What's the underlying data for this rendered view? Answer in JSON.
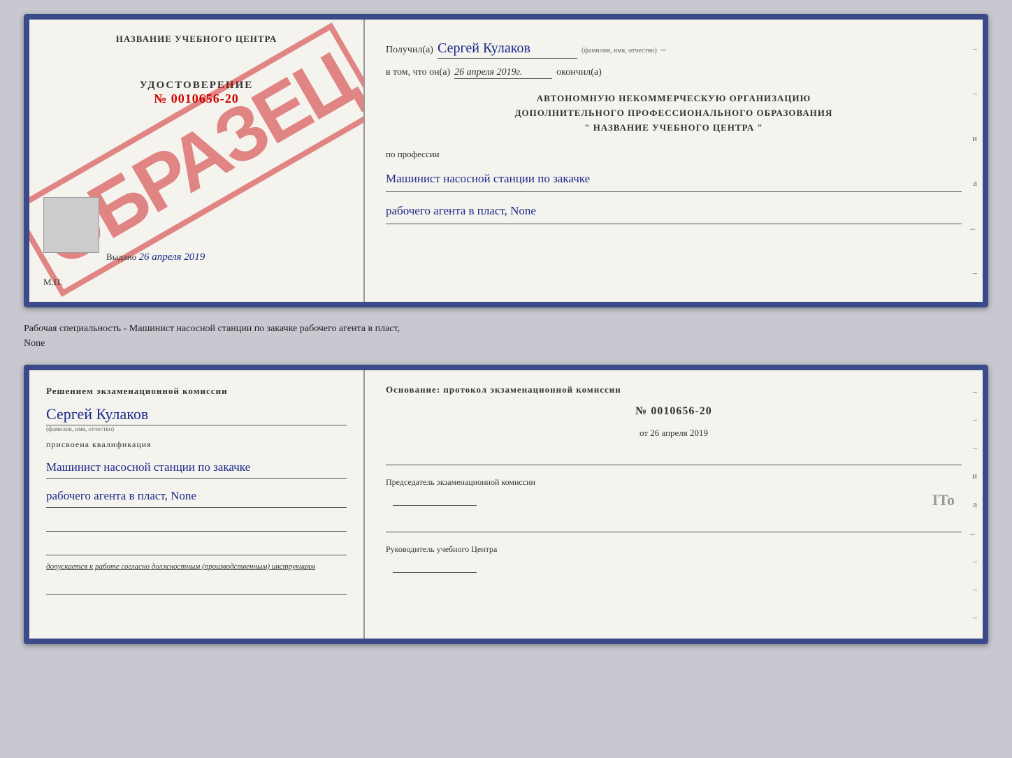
{
  "top_left": {
    "school_name": "НАЗВАНИЕ УЧЕБНОГО ЦЕНТРА",
    "cert_title": "УДОСТОВЕРЕНИЕ",
    "cert_number": "№ 0010656-20",
    "issued_date_label": "Выдано",
    "issued_date": "26 апреля 2019",
    "mp_label": "М.П.",
    "stamp_obrazets": "ОБРАЗЕЦ"
  },
  "top_right": {
    "received_label": "Получил(а)",
    "recipient_name": "Сергей Кулаков",
    "fio_label": "(фамилия, имя, отчество)",
    "date_prefix": "в том, что он(а)",
    "date_value": "26 апреля 2019г.",
    "finished_label": "окончил(а)",
    "org_line1": "АВТОНОМНУЮ НЕКОММЕРЧЕСКУЮ ОРГАНИЗАЦИЮ",
    "org_line2": "ДОПОЛНИТЕЛЬНОГО ПРОФЕССИОНАЛЬНОГО ОБРАЗОВАНИЯ",
    "org_line3": "\" НАЗВАНИЕ УЧЕБНОГО ЦЕНТРА \"",
    "profession_label": "по профессии",
    "profession_line1": "Машинист насосной станции по закачке",
    "profession_line2": "рабочего агента в пласт, None"
  },
  "between_text": "Рабочая специальность - Машинист насосной станции по закачке рабочего агента в пласт,",
  "between_text2": "None",
  "bottom_left": {
    "commission_text": "Решением экзаменационной комиссии",
    "person_name": "Сергей Кулаков",
    "fio_sub": "(фамилия, имя, отчество)",
    "qualification_label": "присвоена квалификация",
    "qualification_line1": "Машинист насосной станции по закачке",
    "qualification_line2": "рабочего агента в пласт, None",
    "допускается_prefix": "допускается к",
    "допускается_text": "работе согласно должностным (производственным) инструкциям"
  },
  "bottom_right": {
    "osnование_label": "Основание: протокол экзаменационной комиссии",
    "protocol_number": "№ 0010656-20",
    "protocol_date_prefix": "от",
    "protocol_date": "26 апреля 2019",
    "chairman_title": "Председатель экзаменационной комиссии",
    "head_title": "Руководитель учебного Центра"
  },
  "side_marks": [
    "и",
    "а",
    "←",
    "–",
    "–",
    "–",
    "–",
    "–"
  ],
  "ito_mark": "ITo"
}
